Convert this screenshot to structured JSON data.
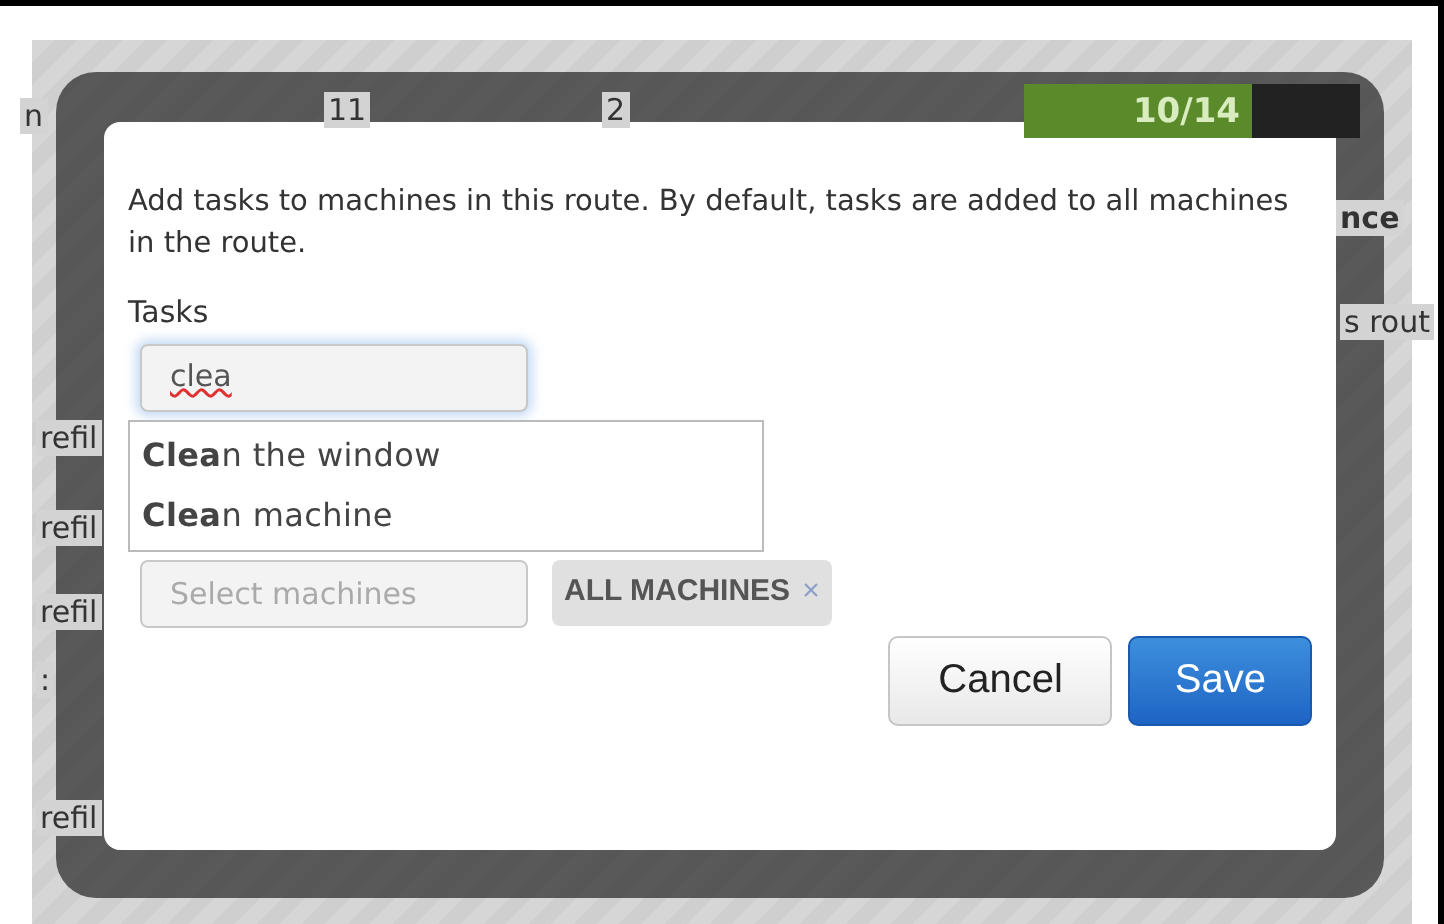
{
  "background": {
    "row_label": "n",
    "col_a": "11",
    "col_b": "2",
    "progress": {
      "reading": "10/14",
      "level": 0.68
    },
    "heading": "nce",
    "note": "s rout",
    "row_texts": [
      "refil",
      "refil",
      "refil",
      ":",
      "refil"
    ]
  },
  "dialog": {
    "description": "Add tasks to machines in this route. By default, tasks are added to all machines in the route.",
    "tasks_label": "Tasks",
    "task_input": {
      "value": "clea",
      "spellcheck_error": true
    },
    "suggestions": [
      {
        "text": "**Clea**n the window"
      },
      {
        "text": "**Clea**n machine"
      }
    ],
    "machines_input": {
      "placeholder": "Select machines"
    },
    "tags": [
      {
        "label": "ALL MACHINES",
        "remove": "×"
      }
    ],
    "buttons": [
      {
        "label": "Cancel",
        "kind": "secondary"
      },
      {
        "label": "Save",
        "kind": "primary"
      }
    ]
  }
}
